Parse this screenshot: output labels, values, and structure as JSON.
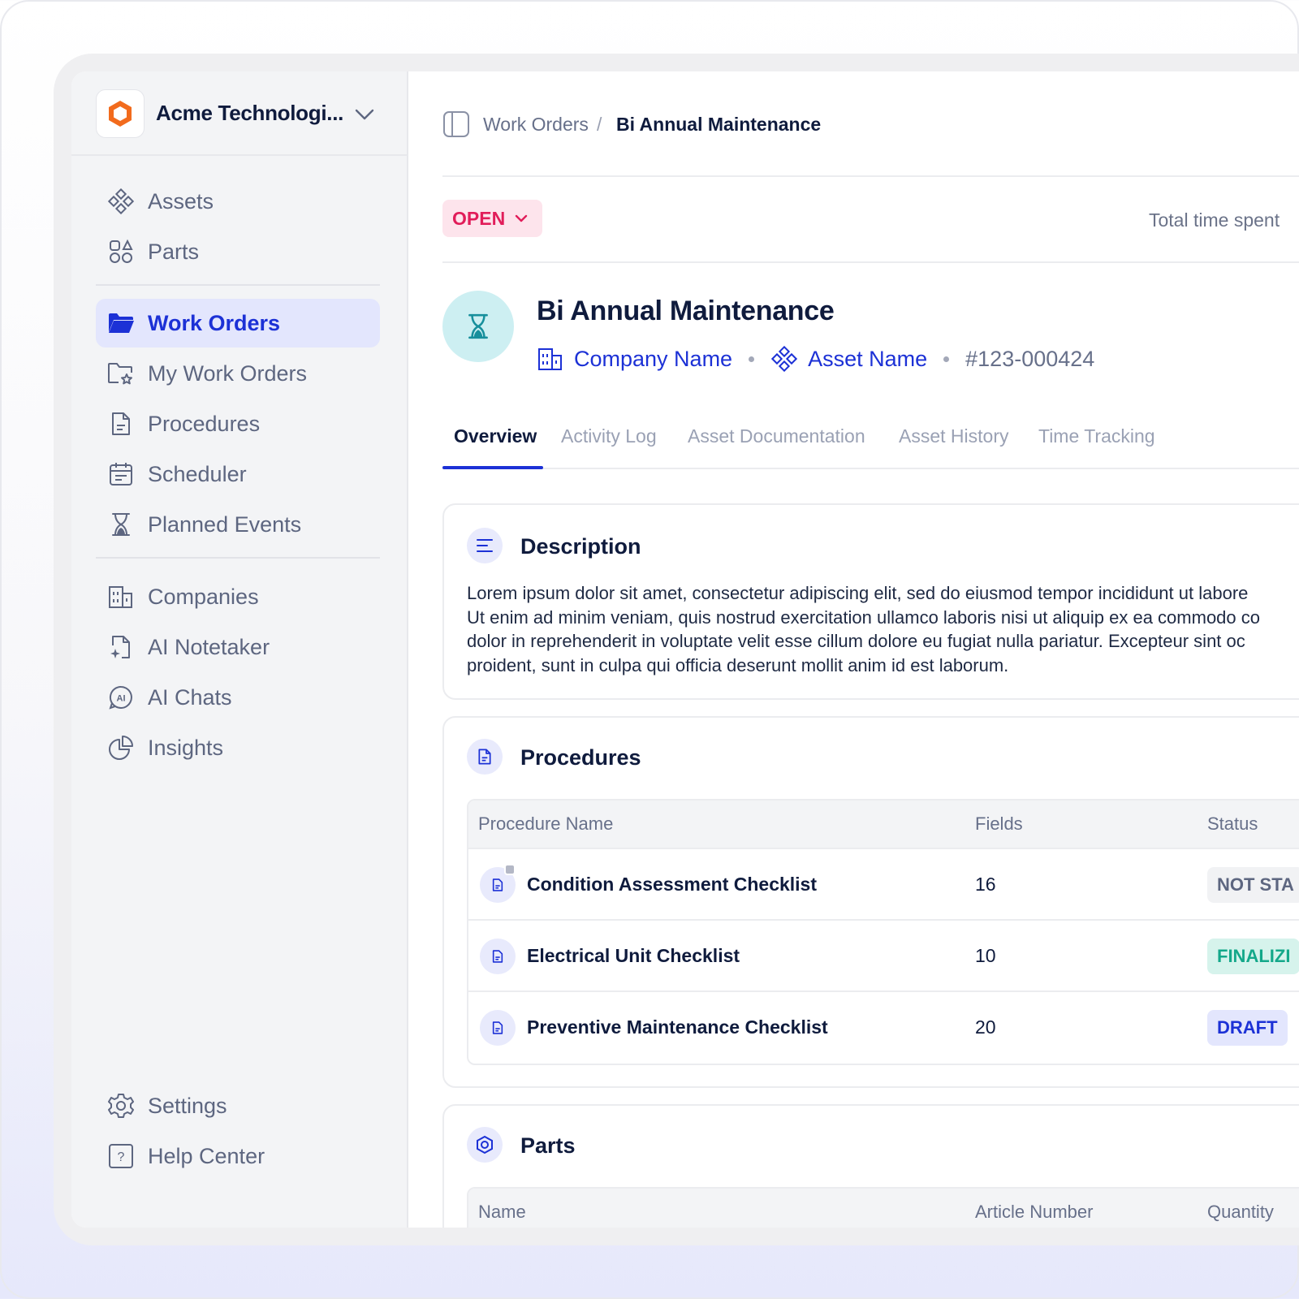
{
  "org": {
    "name": "Acme Technologi..."
  },
  "sidebar": {
    "items": [
      {
        "label": "Assets",
        "icon": "assets-icon"
      },
      {
        "label": "Parts",
        "icon": "parts-icon"
      },
      {
        "label": "Work Orders",
        "icon": "folder-icon",
        "active": true
      },
      {
        "label": "My Work Orders",
        "icon": "folder-star-icon"
      },
      {
        "label": "Procedures",
        "icon": "document-icon"
      },
      {
        "label": "Scheduler",
        "icon": "calendar-icon"
      },
      {
        "label": "Planned Events",
        "icon": "hourglass-icon"
      },
      {
        "label": "Companies",
        "icon": "building-icon"
      },
      {
        "label": "AI Notetaker",
        "icon": "ai-notetaker-icon"
      },
      {
        "label": "AI Chats",
        "icon": "ai-chat-icon"
      },
      {
        "label": "Insights",
        "icon": "pie-chart-icon"
      }
    ],
    "footer": [
      {
        "label": "Settings",
        "icon": "gear-icon"
      },
      {
        "label": "Help Center",
        "icon": "help-icon"
      }
    ]
  },
  "breadcrumb": {
    "parent": "Work Orders",
    "separator": "/",
    "current": "Bi Annual Maintenance"
  },
  "status": {
    "label": "OPEN",
    "color": "#e11d5a"
  },
  "total_time_label": "Total time spent",
  "work_order": {
    "title": "Bi Annual Maintenance",
    "company": "Company Name",
    "asset": "Asset Name",
    "id": "#123-000424"
  },
  "tabs": [
    {
      "label": "Overview",
      "active": true
    },
    {
      "label": "Activity Log"
    },
    {
      "label": "Asset Documentation"
    },
    {
      "label": "Asset History"
    },
    {
      "label": "Time Tracking"
    }
  ],
  "description": {
    "title": "Description",
    "lines": [
      "Lorem ipsum dolor sit amet, consectetur adipiscing elit, sed do eiusmod tempor incididunt ut labore",
      "Ut enim ad minim veniam, quis nostrud exercitation ullamco laboris nisi ut aliquip ex ea commodo co",
      "dolor in reprehenderit in voluptate velit esse cillum dolore eu fugiat nulla pariatur. Excepteur sint oc",
      "proident, sunt in culpa qui officia deserunt mollit anim id est laborum."
    ]
  },
  "procedures": {
    "title": "Procedures",
    "columns": [
      "Procedure Name",
      "Fields",
      "Status"
    ],
    "rows": [
      {
        "name": "Condition Assessment Checklist",
        "fields": "16",
        "status": "NOT STA",
        "status_fg": "#5d6680",
        "status_bg": "#f1f2f4"
      },
      {
        "name": "Electrical Unit Checklist",
        "fields": "10",
        "status": "FINALIZI",
        "status_fg": "#14a88a",
        "status_bg": "#d6f3ec"
      },
      {
        "name": "Preventive Maintenance Checklist",
        "fields": "20",
        "status": "DRAFT",
        "status_fg": "#1c31d6",
        "status_bg": "#e3e6fd"
      }
    ]
  },
  "parts": {
    "title": "Parts",
    "columns": [
      "Name",
      "Article Number",
      "Quantity"
    ]
  }
}
